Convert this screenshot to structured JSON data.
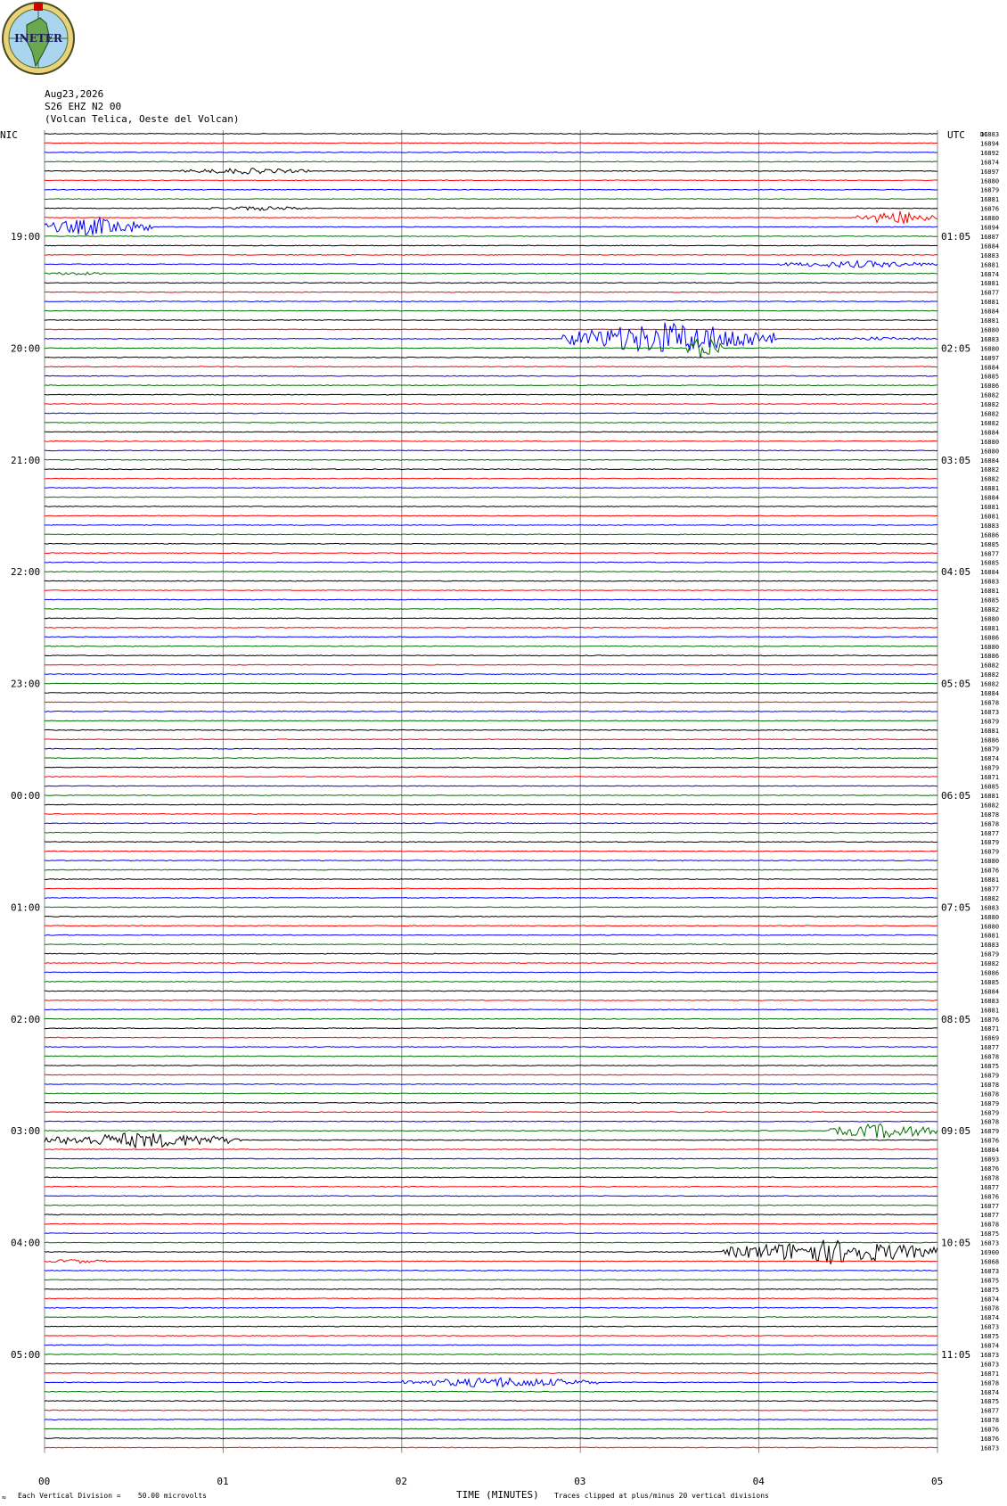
{
  "header": {
    "logo_text": "INETER",
    "date": "Aug23,2026",
    "station": "S26 EHZ N2 00",
    "location": "(Volcan Telica, Oeste del Volcan)",
    "left_zone": "NIC",
    "right_zone": "UTC",
    "dc_label": "DC"
  },
  "footer": {
    "scale_note": "Each Vertical Division =    50.00 microvolts",
    "xlabel": "TIME (MINUTES)",
    "clip_note": "Traces clipped at plus/minus 20 vertical divisions",
    "corner_mark": "≈"
  },
  "colors": {
    "cycle": [
      "#000000",
      "#ff0000",
      "#0000ff",
      "#007000"
    ],
    "grid": "#8a8a8a"
  },
  "chart_data": {
    "type": "line",
    "title": "",
    "xlabel": "TIME (MINUTES)",
    "ylabel": "",
    "xlim": [
      0,
      5
    ],
    "x_ticks": [
      "00",
      "01",
      "02",
      "03",
      "04",
      "05"
    ],
    "trace_count": 96,
    "left_time_labels": [
      {
        "row": 12,
        "label": "19:00"
      },
      {
        "row": 24,
        "label": "20:00"
      },
      {
        "row": 36,
        "label": "21:00"
      },
      {
        "row": 48,
        "label": "22:00"
      },
      {
        "row": 60,
        "label": "23:00"
      },
      {
        "row": 72,
        "label": "00:00"
      },
      {
        "row": 84,
        "label": "01:00"
      },
      {
        "row": 96,
        "label": "02:00"
      },
      {
        "row": 108,
        "label": "03:00"
      },
      {
        "row": 120,
        "label": "04:00"
      },
      {
        "row": 132,
        "label": "05:00"
      }
    ],
    "right_time_labels": [
      {
        "row": 12,
        "label": "01:05"
      },
      {
        "row": 24,
        "label": "02:05"
      },
      {
        "row": 36,
        "label": "03:05"
      },
      {
        "row": 48,
        "label": "04:05"
      },
      {
        "row": 60,
        "label": "05:05"
      },
      {
        "row": 72,
        "label": "06:05"
      },
      {
        "row": 84,
        "label": "07:05"
      },
      {
        "row": 96,
        "label": "08:05"
      },
      {
        "row": 108,
        "label": "09:05"
      },
      {
        "row": 120,
        "label": "10:05"
      },
      {
        "row": 132,
        "label": "11:05"
      }
    ],
    "dc_offsets": [
      16883,
      16894,
      16892,
      16874,
      16897,
      16880,
      16879,
      16881,
      16876,
      16880,
      16894,
      16887,
      16884,
      16883,
      16881,
      16874,
      16881,
      16877,
      16881,
      16884,
      16881,
      16880,
      16883,
      16880,
      16897,
      16884,
      16885,
      16886,
      16882,
      16882,
      16882,
      16882,
      16884,
      16880,
      16880,
      16884,
      16882,
      16882,
      16881,
      16884,
      16881,
      16881,
      16883,
      16886,
      16885,
      16877,
      16885,
      16884,
      16883,
      16881,
      16885,
      16882,
      16880,
      16881,
      16886,
      16880,
      16886,
      16882,
      16882,
      16882,
      16884,
      16878,
      16873,
      16879,
      16881,
      16886,
      16879,
      16874,
      16879,
      16871,
      16885,
      16881,
      16882,
      16878,
      16878,
      16877,
      16879,
      16879,
      16880,
      16876,
      16881,
      16877,
      16882,
      16883,
      16880,
      16880,
      16881,
      16883,
      16879,
      16882,
      16886,
      16885,
      16884,
      16883,
      16881,
      16876,
      16871,
      16869,
      16877,
      16878,
      16875,
      16879,
      16878,
      16878,
      16879,
      16879,
      16878,
      16879,
      16876,
      16884,
      16893,
      16876,
      16878,
      16877,
      16876,
      16877,
      16877,
      16878,
      16875,
      16873,
      16900,
      16868,
      16873,
      16875,
      16875,
      16874,
      16878,
      16874,
      16873,
      16875,
      16874,
      16873,
      16873,
      16871,
      16878,
      16874,
      16875,
      16877,
      16878,
      16876,
      16876,
      16873
    ],
    "events": [
      {
        "trace": 4,
        "start": 0.75,
        "end": 1.5,
        "amp": 7
      },
      {
        "trace": 8,
        "start": 0.9,
        "end": 1.5,
        "amp": 5
      },
      {
        "trace": 9,
        "start": 4.55,
        "end": 5.0,
        "amp": 16
      },
      {
        "trace": 10,
        "start": 0.0,
        "end": 0.6,
        "amp": 22
      },
      {
        "trace": 14,
        "start": 4.1,
        "end": 5.0,
        "amp": 8
      },
      {
        "trace": 15,
        "start": 0.0,
        "end": 0.35,
        "amp": 4
      },
      {
        "trace": 22,
        "start": 2.9,
        "end": 4.1,
        "amp": 38
      },
      {
        "trace": 22,
        "start": 4.3,
        "end": 5.0,
        "amp": 4
      },
      {
        "trace": 23,
        "start": 3.6,
        "end": 3.8,
        "amp": 30
      },
      {
        "trace": 108,
        "start": 0.0,
        "end": 1.1,
        "amp": 18
      },
      {
        "trace": 107,
        "start": 4.4,
        "end": 5.0,
        "amp": 18
      },
      {
        "trace": 120,
        "start": 3.8,
        "end": 5.0,
        "amp": 28
      },
      {
        "trace": 121,
        "start": 0.0,
        "end": 0.35,
        "amp": 5
      },
      {
        "trace": 134,
        "start": 2.0,
        "end": 3.1,
        "amp": 12
      }
    ]
  }
}
